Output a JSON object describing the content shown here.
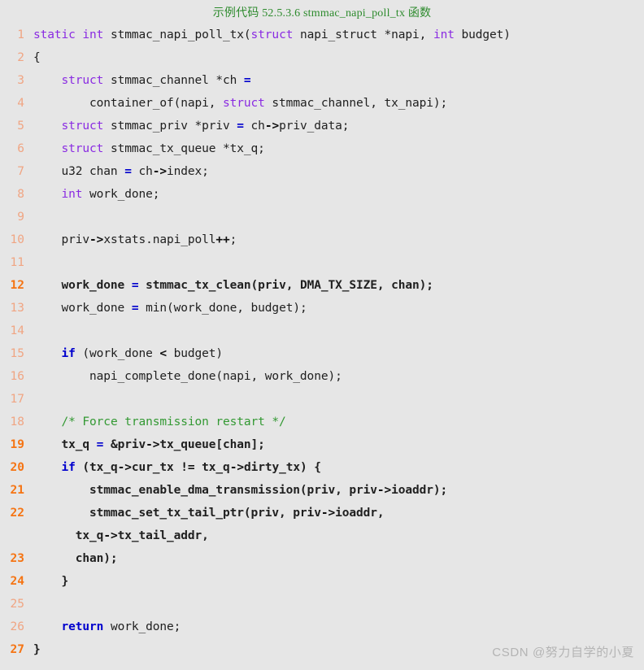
{
  "title": "示例代码 52.5.3.6 stmmac_napi_poll_tx 函数",
  "watermark": "CSDN @努力自学的小夏",
  "colors": {
    "background": "#e6e6e6",
    "title": "#2e8b2e",
    "line_number": "#f0a583",
    "line_number_highlight": "#f57413",
    "keyword_type": "#8a2be2",
    "keyword_control": "#0000cd",
    "operator": "#0000cd",
    "comment": "#339933",
    "plain_text": "#202020",
    "watermark": "#b4b4b4"
  },
  "language": "c",
  "lines": [
    {
      "num": "1",
      "bold": false,
      "tokens": [
        {
          "t": "static",
          "c": "k-type"
        },
        {
          "t": " ",
          "c": "plain"
        },
        {
          "t": "int",
          "c": "k-type"
        },
        {
          "t": " stmmac_napi_poll_tx(",
          "c": "plain"
        },
        {
          "t": "struct",
          "c": "k-type"
        },
        {
          "t": " napi_struct *napi, ",
          "c": "plain"
        },
        {
          "t": "int",
          "c": "k-type"
        },
        {
          "t": " budget)",
          "c": "plain"
        }
      ]
    },
    {
      "num": "2",
      "bold": false,
      "tokens": [
        {
          "t": "{",
          "c": "plain"
        }
      ]
    },
    {
      "num": "3",
      "bold": false,
      "tokens": [
        {
          "t": "    ",
          "c": "plain"
        },
        {
          "t": "struct",
          "c": "k-type"
        },
        {
          "t": " stmmac_channel *ch ",
          "c": "plain"
        },
        {
          "t": "=",
          "c": "op"
        }
      ]
    },
    {
      "num": "4",
      "bold": false,
      "tokens": [
        {
          "t": "        container_of(napi, ",
          "c": "plain"
        },
        {
          "t": "struct",
          "c": "k-type"
        },
        {
          "t": " stmmac_channel, tx_napi);",
          "c": "plain"
        }
      ]
    },
    {
      "num": "5",
      "bold": false,
      "tokens": [
        {
          "t": "    ",
          "c": "plain"
        },
        {
          "t": "struct",
          "c": "k-type"
        },
        {
          "t": " stmmac_priv *priv ",
          "c": "plain"
        },
        {
          "t": "=",
          "c": "op"
        },
        {
          "t": " ch",
          "c": "plain"
        },
        {
          "t": "->",
          "c": "op-dark"
        },
        {
          "t": "priv_data;",
          "c": "plain"
        }
      ]
    },
    {
      "num": "6",
      "bold": false,
      "tokens": [
        {
          "t": "    ",
          "c": "plain"
        },
        {
          "t": "struct",
          "c": "k-type"
        },
        {
          "t": " stmmac_tx_queue *tx_q;",
          "c": "plain"
        }
      ]
    },
    {
      "num": "7",
      "bold": false,
      "tokens": [
        {
          "t": "    u32 chan ",
          "c": "plain"
        },
        {
          "t": "=",
          "c": "op"
        },
        {
          "t": " ch",
          "c": "plain"
        },
        {
          "t": "->",
          "c": "op-dark"
        },
        {
          "t": "index;",
          "c": "plain"
        }
      ]
    },
    {
      "num": "8",
      "bold": false,
      "tokens": [
        {
          "t": "    ",
          "c": "plain"
        },
        {
          "t": "int",
          "c": "k-type"
        },
        {
          "t": " work_done;",
          "c": "plain"
        }
      ]
    },
    {
      "num": "9",
      "bold": false,
      "tokens": [
        {
          "t": "",
          "c": "plain"
        }
      ]
    },
    {
      "num": "10",
      "bold": false,
      "tokens": [
        {
          "t": "    priv",
          "c": "plain"
        },
        {
          "t": "->",
          "c": "op-dark"
        },
        {
          "t": "xstats.napi_poll",
          "c": "plain"
        },
        {
          "t": "++",
          "c": "op-dark"
        },
        {
          "t": ";",
          "c": "plain"
        }
      ]
    },
    {
      "num": "11",
      "bold": false,
      "tokens": [
        {
          "t": "",
          "c": "plain"
        }
      ]
    },
    {
      "num": "12",
      "bold": true,
      "tokens": [
        {
          "t": "    work_done ",
          "c": "plain"
        },
        {
          "t": "=",
          "c": "op"
        },
        {
          "t": " stmmac_tx_clean(priv, DMA_TX_SIZE, chan);",
          "c": "plain"
        }
      ]
    },
    {
      "num": "13",
      "bold": false,
      "tokens": [
        {
          "t": "    work_done ",
          "c": "plain"
        },
        {
          "t": "=",
          "c": "op"
        },
        {
          "t": " min(work_done, budget);",
          "c": "plain"
        }
      ]
    },
    {
      "num": "14",
      "bold": false,
      "tokens": [
        {
          "t": "",
          "c": "plain"
        }
      ]
    },
    {
      "num": "15",
      "bold": false,
      "tokens": [
        {
          "t": "    ",
          "c": "plain"
        },
        {
          "t": "if",
          "c": "k-ctrl"
        },
        {
          "t": " (work_done ",
          "c": "plain"
        },
        {
          "t": "<",
          "c": "op-dark"
        },
        {
          "t": " budget)",
          "c": "plain"
        }
      ]
    },
    {
      "num": "16",
      "bold": false,
      "tokens": [
        {
          "t": "        napi_complete_done(napi, work_done);",
          "c": "plain"
        }
      ]
    },
    {
      "num": "17",
      "bold": false,
      "tokens": [
        {
          "t": "",
          "c": "plain"
        }
      ]
    },
    {
      "num": "18",
      "bold": false,
      "tokens": [
        {
          "t": "    ",
          "c": "plain"
        },
        {
          "t": "/* Force transmission restart */",
          "c": "cmt"
        }
      ]
    },
    {
      "num": "19",
      "bold": true,
      "tokens": [
        {
          "t": "    tx_q ",
          "c": "plain"
        },
        {
          "t": "=",
          "c": "op"
        },
        {
          "t": " &priv",
          "c": "plain"
        },
        {
          "t": "->",
          "c": "op-dark"
        },
        {
          "t": "tx_queue[chan];",
          "c": "plain"
        }
      ]
    },
    {
      "num": "20",
      "bold": true,
      "tokens": [
        {
          "t": "    ",
          "c": "plain"
        },
        {
          "t": "if",
          "c": "k-ctrl"
        },
        {
          "t": " (tx_q",
          "c": "plain"
        },
        {
          "t": "->",
          "c": "op-dark"
        },
        {
          "t": "cur_tx ",
          "c": "plain"
        },
        {
          "t": "!=",
          "c": "op-dark"
        },
        {
          "t": " tx_q",
          "c": "plain"
        },
        {
          "t": "->",
          "c": "op-dark"
        },
        {
          "t": "dirty_tx) {",
          "c": "plain"
        }
      ]
    },
    {
      "num": "21",
      "bold": true,
      "tokens": [
        {
          "t": "        stmmac_enable_dma_transmission(priv, priv",
          "c": "plain"
        },
        {
          "t": "->",
          "c": "op-dark"
        },
        {
          "t": "ioaddr);",
          "c": "plain"
        }
      ]
    },
    {
      "num": "22",
      "bold": true,
      "tokens": [
        {
          "t": "        stmmac_set_tx_tail_ptr(priv, priv",
          "c": "plain"
        },
        {
          "t": "->",
          "c": "op-dark"
        },
        {
          "t": "ioaddr,",
          "c": "plain"
        }
      ]
    },
    {
      "num": "",
      "bold": true,
      "tokens": [
        {
          "t": "      tx_q",
          "c": "plain"
        },
        {
          "t": "->",
          "c": "op-dark"
        },
        {
          "t": "tx_tail_addr,",
          "c": "plain"
        }
      ]
    },
    {
      "num": "23",
      "bold": true,
      "tokens": [
        {
          "t": "      chan);",
          "c": "plain"
        }
      ]
    },
    {
      "num": "24",
      "bold": true,
      "tokens": [
        {
          "t": "    }",
          "c": "plain"
        }
      ]
    },
    {
      "num": "25",
      "bold": false,
      "tokens": [
        {
          "t": "",
          "c": "plain"
        }
      ]
    },
    {
      "num": "26",
      "bold": false,
      "tokens": [
        {
          "t": "    ",
          "c": "plain"
        },
        {
          "t": "return",
          "c": "k-ctrl"
        },
        {
          "t": " work_done;",
          "c": "plain"
        }
      ]
    },
    {
      "num": "27",
      "bold": true,
      "tokens": [
        {
          "t": "}",
          "c": "plain"
        }
      ]
    }
  ]
}
